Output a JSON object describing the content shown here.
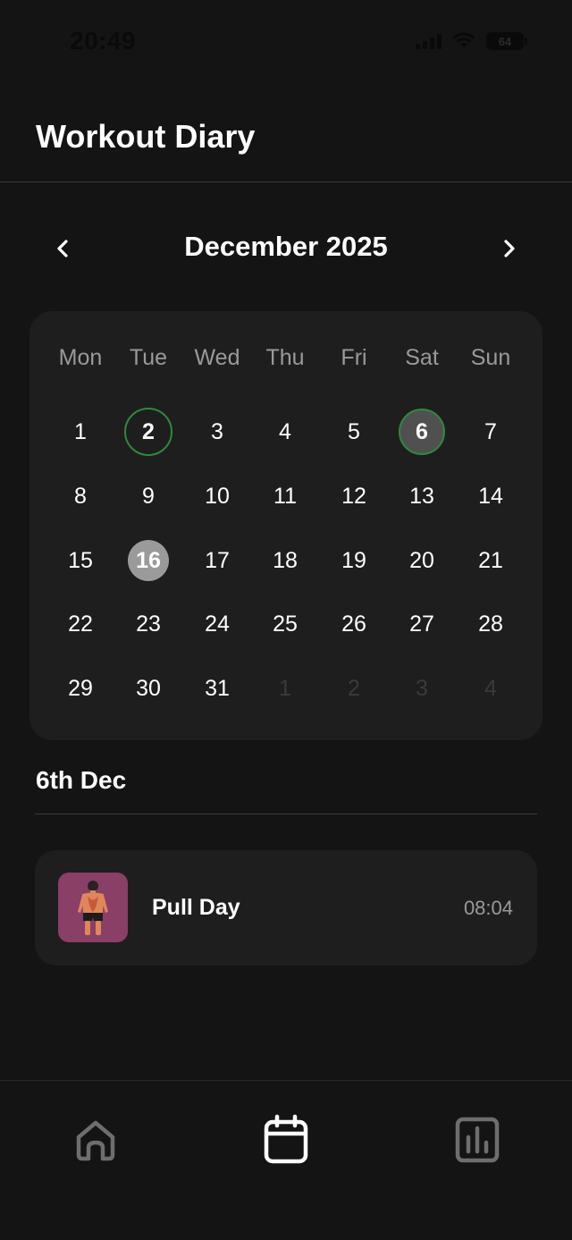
{
  "status_bar": {
    "time": "20:49",
    "battery": "64"
  },
  "header": {
    "title": "Workout Diary"
  },
  "calendar": {
    "month_label": "December 2025",
    "weekdays": [
      "Mon",
      "Tue",
      "Wed",
      "Thu",
      "Fri",
      "Sat",
      "Sun"
    ],
    "weeks": [
      [
        "1",
        "2",
        "3",
        "4",
        "5",
        "6",
        "7"
      ],
      [
        "8",
        "9",
        "10",
        "11",
        "12",
        "13",
        "14"
      ],
      [
        "15",
        "16",
        "17",
        "18",
        "19",
        "20",
        "21"
      ],
      [
        "22",
        "23",
        "24",
        "25",
        "26",
        "27",
        "28"
      ],
      [
        "29",
        "30",
        "31",
        "1",
        "2",
        "3",
        "4"
      ]
    ],
    "workout_days": [
      "2",
      "6"
    ],
    "selected_day": "6",
    "today": "16",
    "workout_ring_color": "#2e8b3a"
  },
  "selected_date": {
    "heading": "6th Dec",
    "workouts": [
      {
        "name": "Pull Day",
        "time": "08:04",
        "icon": "back-muscles-figure-icon",
        "thumb_color": "#8a3f66"
      }
    ]
  },
  "tab_bar": {
    "items": [
      {
        "icon": "home-icon",
        "active": false
      },
      {
        "icon": "calendar-icon",
        "active": true
      },
      {
        "icon": "bar-chart-icon",
        "active": false
      }
    ]
  }
}
